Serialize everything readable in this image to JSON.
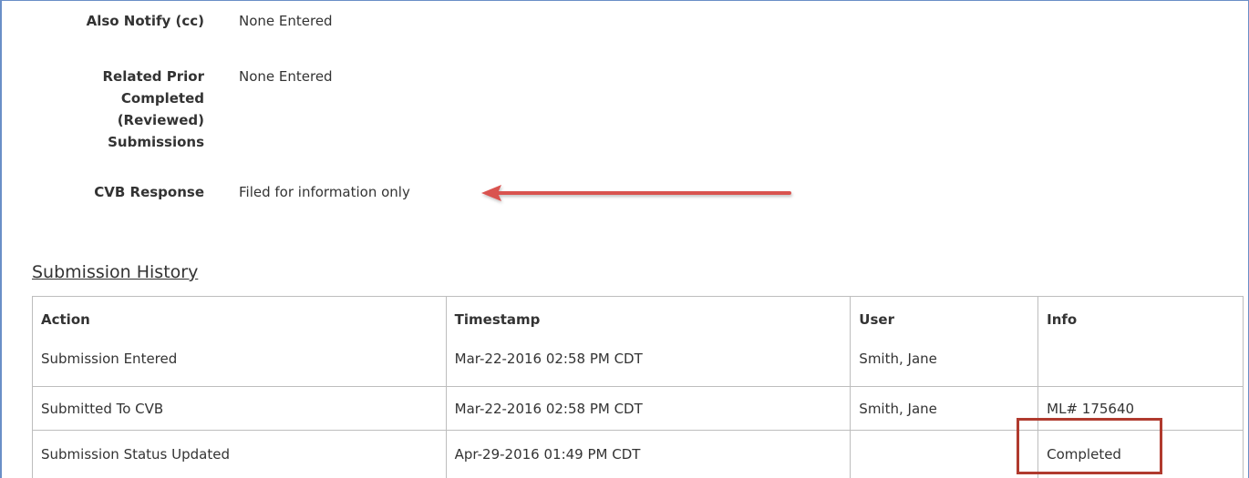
{
  "details": {
    "also_notify": {
      "label": "Also Notify (cc)",
      "value": "None Entered"
    },
    "related_prior": {
      "label_lines": [
        "Related Prior",
        "Completed",
        "(Reviewed)",
        "Submissions"
      ],
      "value": "None Entered"
    },
    "cvb_response": {
      "label": "CVB Response",
      "value": "Filed for information only"
    }
  },
  "annotations": {
    "arrow_color": "#d9534f",
    "highlight_color": "#b03a2e"
  },
  "history": {
    "title": "Submission History",
    "columns": [
      "Action",
      "Timestamp",
      "User",
      "Info"
    ],
    "rows": [
      {
        "action": "Submission Entered",
        "timestamp": "Mar-22-2016 02:58 PM CDT",
        "user": "Smith, Jane",
        "info": ""
      },
      {
        "action": "Submitted To CVB",
        "timestamp": "Mar-22-2016 02:58 PM CDT",
        "user": "Smith, Jane",
        "info": "ML# 175640"
      },
      {
        "action": "Submission Status Updated",
        "timestamp": "Apr-29-2016 01:49 PM CDT",
        "user": "",
        "info": "Completed"
      }
    ]
  }
}
